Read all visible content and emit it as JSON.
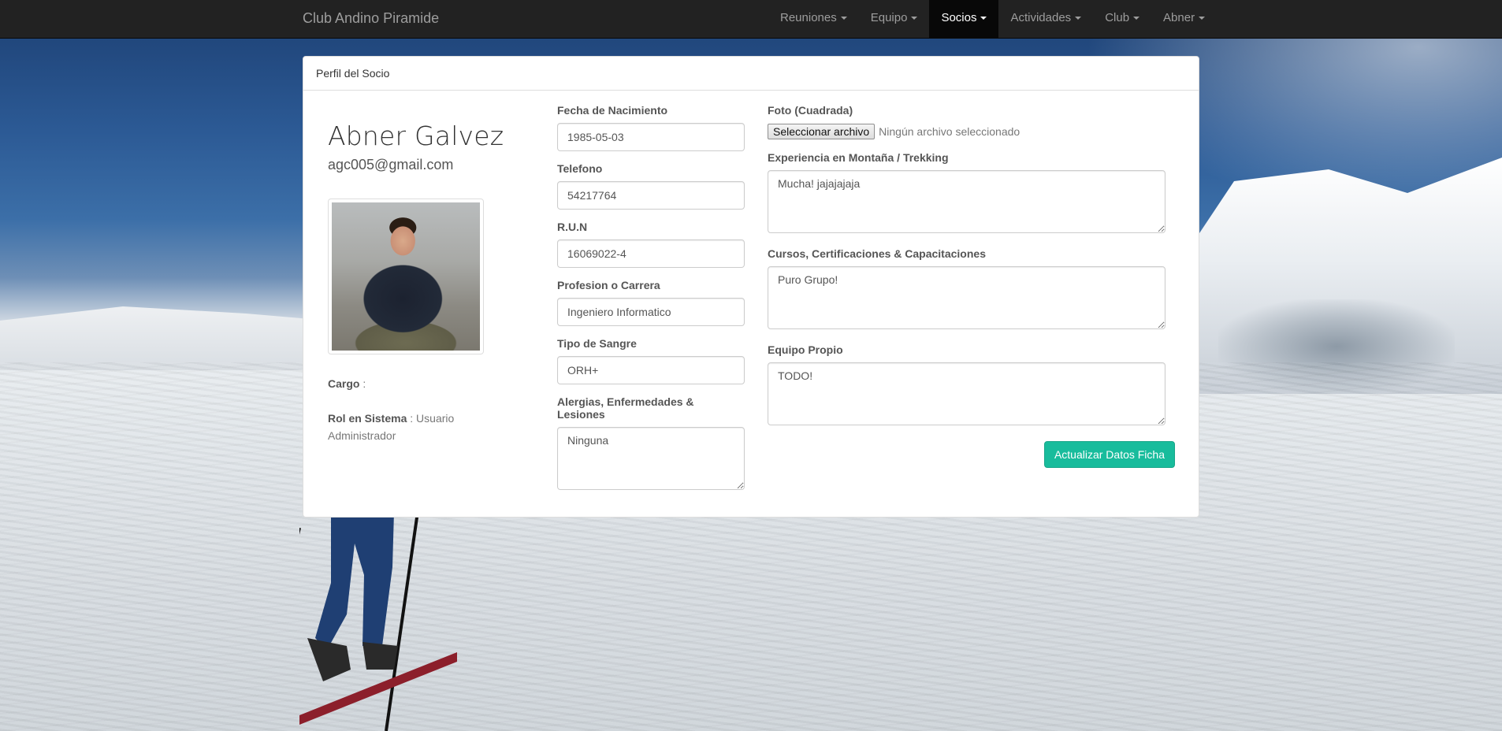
{
  "navbar": {
    "brand": "Club Andino Piramide",
    "items": [
      {
        "label": "Reuniones",
        "active": false
      },
      {
        "label": "Equipo",
        "active": false
      },
      {
        "label": "Socios",
        "active": true
      },
      {
        "label": "Actividades",
        "active": false
      },
      {
        "label": "Club",
        "active": false
      },
      {
        "label": "Abner",
        "active": false
      }
    ]
  },
  "panel": {
    "heading": "Perfil del Socio"
  },
  "profile": {
    "name": "Abner Galvez",
    "email": "agc005@gmail.com",
    "cargo_label": "Cargo",
    "cargo_value": "",
    "rol_label": "Rol en Sistema",
    "rol_value": "Usuario Administrador"
  },
  "form": {
    "birth": {
      "label": "Fecha de Nacimiento",
      "value": "1985-05-03"
    },
    "phone": {
      "label": "Telefono",
      "value": "54217764"
    },
    "run": {
      "label": "R.U.N",
      "value": "16069022-4"
    },
    "profession": {
      "label": "Profesion o Carrera",
      "value": "Ingeniero Informatico"
    },
    "blood": {
      "label": "Tipo de Sangre",
      "value": "ORH+"
    },
    "allergies": {
      "label": "Alergias, Enfermedades & Lesiones",
      "value": "Ninguna"
    },
    "photo": {
      "label": "Foto (Cuadrada)",
      "button": "Seleccionar archivo",
      "status": "Ningún archivo seleccionado"
    },
    "experience": {
      "label": "Experiencia en Montaña / Trekking",
      "value": "Mucha! jajajajaja"
    },
    "courses": {
      "label": "Cursos, Certificaciones & Capacitaciones",
      "value": "Puro Grupo!"
    },
    "gear": {
      "label": "Equipo Propio",
      "value": "TODO!"
    },
    "submit": "Actualizar Datos Ficha"
  },
  "colors": {
    "navbar_bg": "#222222",
    "accent": "#18bc9c"
  }
}
